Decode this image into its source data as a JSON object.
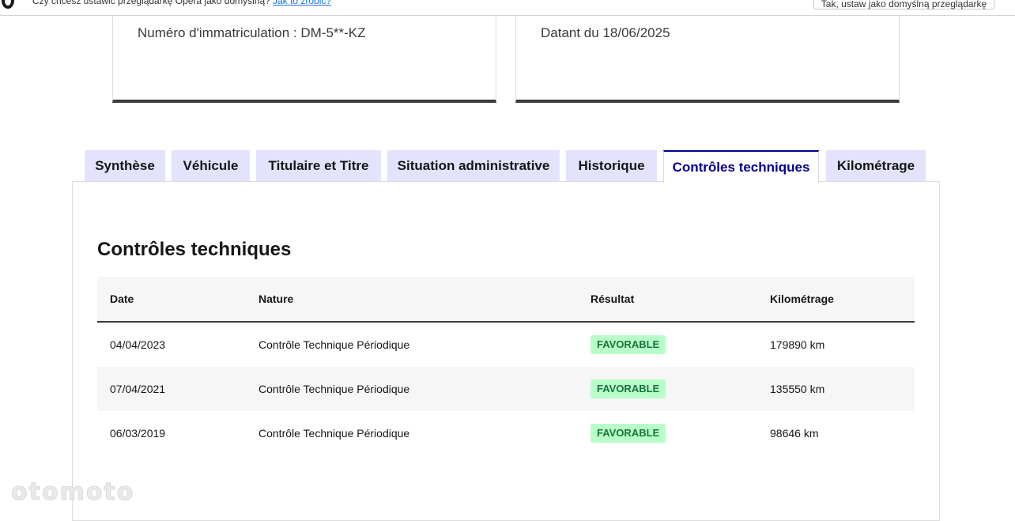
{
  "opera_bar": {
    "message": "Czy chcesz ustawić przeglądarkę Opera jako domyślną?",
    "link": "Jak to zrobić?",
    "button": "Tak, ustaw jako domyślną przeglądarkę"
  },
  "cards": {
    "registration": "Numéro d'immatriculation : DM-5**-KZ",
    "date": "Datant du 18/06/2025"
  },
  "tabs": [
    {
      "label": "Synthèse",
      "active": false
    },
    {
      "label": "Véhicule",
      "active": false
    },
    {
      "label": "Titulaire et Titre",
      "active": false
    },
    {
      "label": "Situation administrative",
      "active": false
    },
    {
      "label": "Historique",
      "active": false
    },
    {
      "label": "Contrôles techniques",
      "active": true
    },
    {
      "label": "Kilométrage",
      "active": false
    }
  ],
  "section": {
    "title": "Contrôles techniques"
  },
  "table": {
    "headers": [
      "Date",
      "Nature",
      "Résultat",
      "Kilométrage"
    ],
    "rows": [
      {
        "date": "04/04/2023",
        "nature": "Contrôle Technique Périodique",
        "result": "FAVORABLE",
        "km": "179890 km"
      },
      {
        "date": "07/04/2021",
        "nature": "Contrôle Technique Périodique",
        "result": "FAVORABLE",
        "km": "135550 km"
      },
      {
        "date": "06/03/2019",
        "nature": "Contrôle Technique Périodique",
        "result": "FAVORABLE",
        "km": "98646 km"
      }
    ]
  },
  "watermark": "otomoto",
  "colors": {
    "accent": "#000091",
    "tab_bg": "#e3e3fd",
    "badge_bg": "#b8fec9",
    "badge_text": "#18753c"
  }
}
